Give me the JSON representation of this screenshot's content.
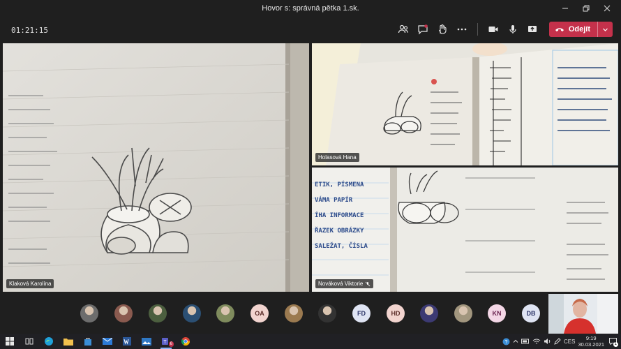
{
  "window": {
    "title": "Hovor s: správná pětka 1.sk."
  },
  "toolbar": {
    "timer": "01:21:15",
    "leave_label": "Odejít",
    "accent": "#c4314b"
  },
  "participants": {
    "main": {
      "name": "Klaková Karolína"
    },
    "top_right": {
      "name": "Holasová Hana"
    },
    "bottom_right": {
      "name": "Nováková Viktorie"
    }
  },
  "notebook_text": [
    "ETIK, PÍSMENA",
    "VÁMA PAPÍR",
    "ÍHA INFORMACE",
    "ŘAZEK OBRÁZKY",
    "SALEŽAT, ČÍSLA"
  ],
  "roster": [
    {
      "type": "photo",
      "color": "#6d6d6d"
    },
    {
      "type": "photo",
      "color": "#8a5a4f"
    },
    {
      "type": "photo",
      "color": "#4c5f3f"
    },
    {
      "type": "photo",
      "color": "#2b4f73"
    },
    {
      "type": "photo",
      "color": "#7f8b5d"
    },
    {
      "type": "initials",
      "label": "OA"
    },
    {
      "type": "photo",
      "color": "#9b7a50"
    },
    {
      "type": "photo",
      "color": "#333333"
    },
    {
      "type": "initials",
      "label": "FD"
    },
    {
      "type": "initials",
      "label": "HD"
    },
    {
      "type": "photo",
      "color": "#3c3a73"
    },
    {
      "type": "photo",
      "color": "#a2967e"
    },
    {
      "type": "initials",
      "label": "KN"
    },
    {
      "type": "initials",
      "label": "DB"
    }
  ],
  "taskbar": {
    "teams_badge": "6",
    "tray_language": "CES",
    "time": "9:19",
    "date": "30.03.2021",
    "notification_count": "1"
  }
}
